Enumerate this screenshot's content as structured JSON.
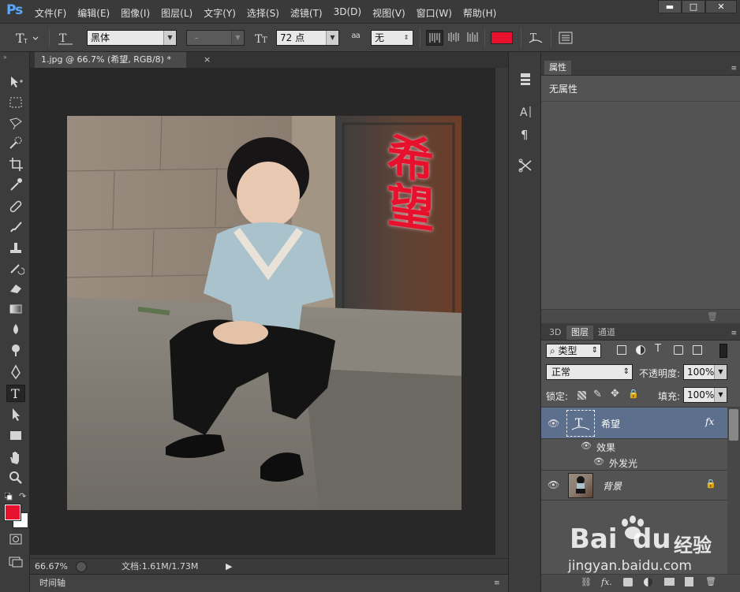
{
  "app": {
    "logo": "Ps",
    "menus": [
      "文件(F)",
      "编辑(E)",
      "图像(I)",
      "图层(L)",
      "文字(Y)",
      "选择(S)",
      "滤镜(T)",
      "3D(D)",
      "视图(V)",
      "窗口(W)",
      "帮助(H)"
    ],
    "window_buttons": {
      "minimize": "▬",
      "maximize": "□",
      "close": "✕"
    }
  },
  "options_bar": {
    "font_family": "黑体",
    "font_style": "-",
    "font_size": "72 点",
    "anti_alias": "无",
    "text_color": "#e8112d",
    "anti_alias_icon_label": "a a"
  },
  "document": {
    "tab_title": "1.jpg @ 66.7% (希望, RGB/8) *",
    "close_glyph": "×",
    "overlay_text": "希望",
    "overlay_color": "#e8112d"
  },
  "status": {
    "zoom": "66.67%",
    "doc_size": "文档:1.61M/1.73M",
    "timeline_label": "时间轴"
  },
  "properties_panel": {
    "tab": "属性",
    "message": "无属性"
  },
  "layers_panel": {
    "tabs": [
      "3D",
      "图层",
      "通道"
    ],
    "filter_kind": "类型",
    "blend_mode": "正常",
    "opacity_label": "不透明度:",
    "opacity_value": "100%",
    "lock_label": "锁定:",
    "fill_label": "填充:",
    "fill_value": "100%",
    "layers": [
      {
        "name": "希望",
        "type": "text",
        "fx": "fx",
        "selected": true
      },
      {
        "name": "效果",
        "type": "effects"
      },
      {
        "name": "外发光",
        "type": "effect"
      },
      {
        "name": "背景",
        "type": "image",
        "locked": true
      }
    ],
    "footer_fx": "fx."
  },
  "watermark": {
    "brand": "Bai",
    "brand_suffix": "经验",
    "url": "jingyan.baidu.com"
  },
  "colors": {
    "foreground": "#e8112d",
    "background": "#ffffff",
    "accent_selected_layer": "#5c6f8c"
  }
}
